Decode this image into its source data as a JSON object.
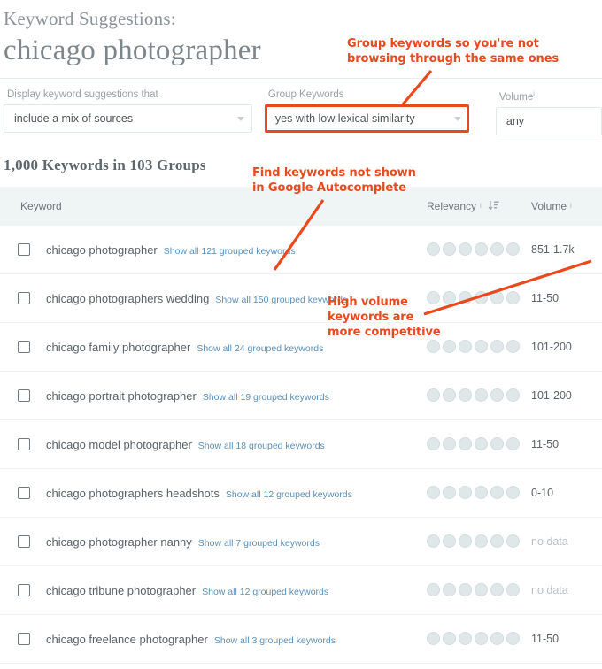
{
  "header": {
    "eyebrow": "Keyword Suggestions:",
    "query": "chicago photographer"
  },
  "filters": {
    "sources": {
      "label": "Display keyword suggestions that",
      "value": "include a mix of sources"
    },
    "group": {
      "label": "Group Keywords",
      "value": "yes with low lexical similarity"
    },
    "volume": {
      "label": "Volume",
      "info": "i",
      "value": "any"
    }
  },
  "summary": {
    "count": "1,000 Keywords  in 103 Groups"
  },
  "table": {
    "columns": {
      "keyword": "Keyword",
      "relevancy": "Relevancy",
      "relevancy_info": "i",
      "volume": "Volume",
      "volume_info": "i",
      "sort_icon": "sort-descending-icon"
    },
    "rows": [
      {
        "keyword": "chicago photographer",
        "link": "Show all 121 grouped keywords",
        "relevancy_dots": 6,
        "volume": "851-1.7k",
        "no_data": false
      },
      {
        "keyword": "chicago photographers wedding",
        "link": "Show all 150 grouped keywords",
        "relevancy_dots": 6,
        "volume": "11-50",
        "no_data": false
      },
      {
        "keyword": "chicago family photographer",
        "link": "Show all 24 grouped keywords",
        "relevancy_dots": 6,
        "volume": "101-200",
        "no_data": false
      },
      {
        "keyword": "chicago portrait photographer",
        "link": "Show all 19 grouped keywords",
        "relevancy_dots": 6,
        "volume": "101-200",
        "no_data": false
      },
      {
        "keyword": "chicago model photographer",
        "link": "Show all 18 grouped keywords",
        "relevancy_dots": 6,
        "volume": "11-50",
        "no_data": false
      },
      {
        "keyword": "chicago photographers headshots",
        "link": "Show all 12 grouped keywords",
        "relevancy_dots": 6,
        "volume": "0-10",
        "no_data": false
      },
      {
        "keyword": "chicago photographer nanny",
        "link": "Show all 7 grouped keywords",
        "relevancy_dots": 6,
        "volume": "no data",
        "no_data": true
      },
      {
        "keyword": "chicago tribune photographer",
        "link": "Show all 12 grouped keywords",
        "relevancy_dots": 6,
        "volume": "no data",
        "no_data": true
      },
      {
        "keyword": "chicago freelance photographer",
        "link": "Show all 3 grouped keywords",
        "relevancy_dots": 6,
        "volume": "11-50",
        "no_data": false
      }
    ]
  },
  "annotations": {
    "group": "Group keywords so you're not\nbrowsing through the same ones",
    "find": "Find keywords not shown\nin Google Autocomplete",
    "volume": "High volume\nkeywords are\nmore competitive"
  },
  "colors": {
    "accent_orange": "#e8491d",
    "link_blue": "#5b8fb9",
    "header_bg": "#eff4f5",
    "dot_gray": "#dfe7e9",
    "text_gray": "#5a6167"
  }
}
